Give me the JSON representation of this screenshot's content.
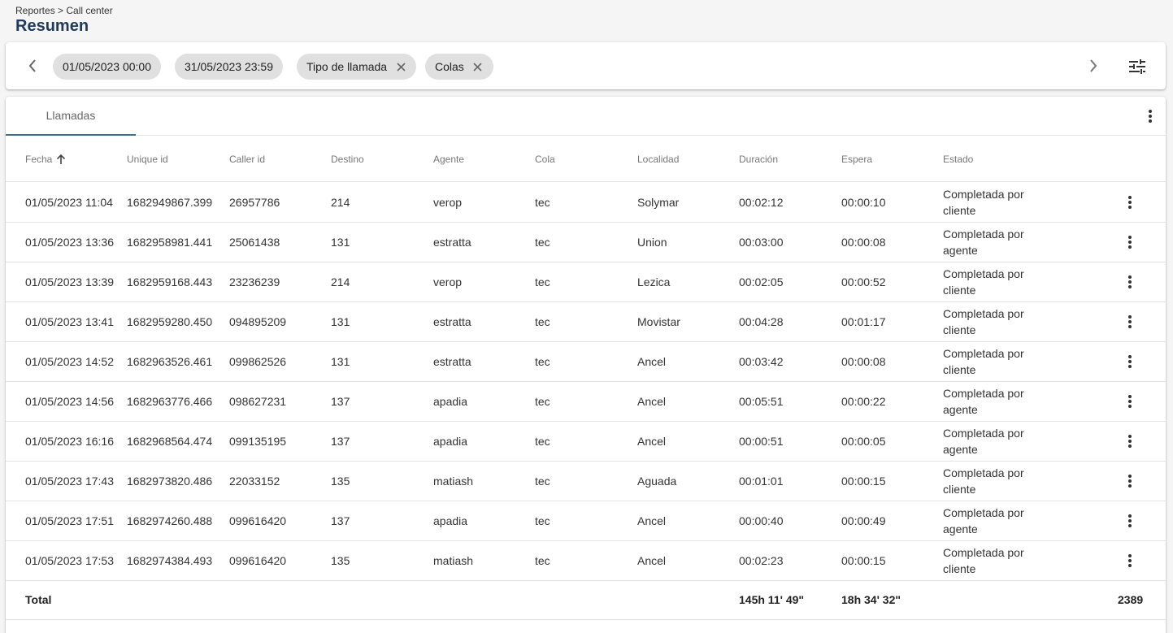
{
  "breadcrumb": "Reportes > Call center",
  "page_title": "Resumen",
  "filters": {
    "date_from": "01/05/2023 00:00",
    "date_to": "31/05/2023 23:59",
    "chip_tipo": "Tipo de llamada",
    "chip_colas": "Colas"
  },
  "tabs": {
    "llamadas": "Llamadas"
  },
  "table": {
    "headers": {
      "fecha": "Fecha",
      "unique_id": "Unique id",
      "caller_id": "Caller id",
      "destino": "Destino",
      "agente": "Agente",
      "cola": "Cola",
      "localidad": "Localidad",
      "duracion": "Duración",
      "espera": "Espera",
      "estado": "Estado"
    },
    "sort": {
      "column": "fecha",
      "direction": "ascending"
    },
    "rows": [
      {
        "fecha": "01/05/2023 11:04",
        "unique_id": "1682949867.399",
        "caller_id": "26957786",
        "destino": "214",
        "agente": "verop",
        "cola": "tec",
        "localidad": "Solymar",
        "duracion": "00:02:12",
        "espera": "00:00:10",
        "estado": "Completada por cliente"
      },
      {
        "fecha": "01/05/2023 13:36",
        "unique_id": "1682958981.441",
        "caller_id": "25061438",
        "destino": "131",
        "agente": "estratta",
        "cola": "tec",
        "localidad": "Union",
        "duracion": "00:03:00",
        "espera": "00:00:08",
        "estado": "Completada por agente"
      },
      {
        "fecha": "01/05/2023 13:39",
        "unique_id": "1682959168.443",
        "caller_id": "23236239",
        "destino": "214",
        "agente": "verop",
        "cola": "tec",
        "localidad": "Lezica",
        "duracion": "00:02:05",
        "espera": "00:00:52",
        "estado": "Completada por cliente"
      },
      {
        "fecha": "01/05/2023 13:41",
        "unique_id": "1682959280.450",
        "caller_id": "094895209",
        "destino": "131",
        "agente": "estratta",
        "cola": "tec",
        "localidad": "Movistar",
        "duracion": "00:04:28",
        "espera": "00:01:17",
        "estado": "Completada por cliente"
      },
      {
        "fecha": "01/05/2023 14:52",
        "unique_id": "1682963526.461",
        "caller_id": "099862526",
        "destino": "131",
        "agente": "estratta",
        "cola": "tec",
        "localidad": "Ancel",
        "duracion": "00:03:42",
        "espera": "00:00:08",
        "estado": "Completada por cliente"
      },
      {
        "fecha": "01/05/2023 14:56",
        "unique_id": "1682963776.466",
        "caller_id": "098627231",
        "destino": "137",
        "agente": "apadia",
        "cola": "tec",
        "localidad": "Ancel",
        "duracion": "00:05:51",
        "espera": "00:00:22",
        "estado": "Completada por agente"
      },
      {
        "fecha": "01/05/2023 16:16",
        "unique_id": "1682968564.474",
        "caller_id": "099135195",
        "destino": "137",
        "agente": "apadia",
        "cola": "tec",
        "localidad": "Ancel",
        "duracion": "00:00:51",
        "espera": "00:00:05",
        "estado": "Completada por agente"
      },
      {
        "fecha": "01/05/2023 17:43",
        "unique_id": "1682973820.486",
        "caller_id": "22033152",
        "destino": "135",
        "agente": "matiash",
        "cola": "tec",
        "localidad": "Aguada",
        "duracion": "00:01:01",
        "espera": "00:00:15",
        "estado": "Completada por cliente"
      },
      {
        "fecha": "01/05/2023 17:51",
        "unique_id": "1682974260.488",
        "caller_id": "099616420",
        "destino": "137",
        "agente": "apadia",
        "cola": "tec",
        "localidad": "Ancel",
        "duracion": "00:00:40",
        "espera": "00:00:49",
        "estado": "Completada por agente"
      },
      {
        "fecha": "01/05/2023 17:53",
        "unique_id": "1682974384.493",
        "caller_id": "099616420",
        "destino": "135",
        "agente": "matiash",
        "cola": "tec",
        "localidad": "Ancel",
        "duracion": "00:02:23",
        "espera": "00:00:15",
        "estado": "Completada por cliente"
      }
    ],
    "total": {
      "label": "Total",
      "duracion": "145h 11' 49\"",
      "espera": "18h 34' 32\"",
      "count": "2389"
    }
  },
  "icons": {
    "prev": "chevron-left-icon",
    "next": "chevron-right-icon",
    "filter_settings": "tune-icon",
    "chip_remove": "close-icon",
    "menu": "more-vert-icon",
    "sort": "arrow-up-icon"
  },
  "colors": {
    "title": "#1f3a5a",
    "tab_indicator": "#3f6e8c",
    "chip_bg": "#e0e0e0",
    "page_bg": "#f5f5f5"
  }
}
